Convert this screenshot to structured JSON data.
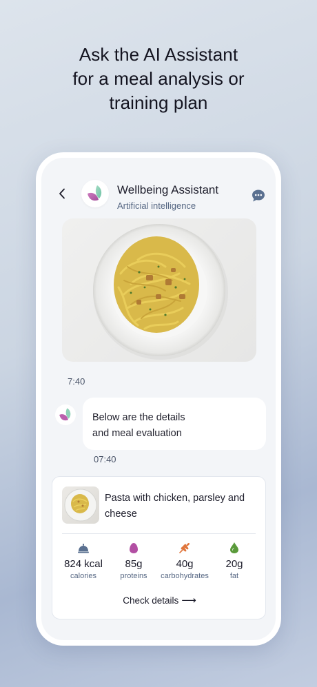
{
  "headline": {
    "line1": "Ask the AI Assistant",
    "line2": "for a meal analysis or",
    "line3": "training plan"
  },
  "header": {
    "title": "Wellbeing Assistant",
    "subtitle": "Artificial intelligence",
    "back_icon": "chevron-left-icon",
    "chat_icon": "chat-bubble-icon"
  },
  "messages": {
    "image_time": "7:40",
    "bot_text_line1": "Below are the details",
    "bot_text_line2": "and meal evaluation",
    "bot_time": "07:40"
  },
  "meal_card": {
    "title": "Pasta with chicken, parsley and cheese",
    "nutrients": [
      {
        "value": "824 kcal",
        "label": "calories",
        "icon": "cloche-icon",
        "color": "#5a7090"
      },
      {
        "value": "85g",
        "label": "proteins",
        "icon": "egg-icon",
        "color": "#b24fa3"
      },
      {
        "value": "40g",
        "label": "carbohydrates",
        "icon": "wheat-icon",
        "color": "#e0753b"
      },
      {
        "value": "20g",
        "label": "fat",
        "icon": "drop-icon",
        "color": "#5a9a3a"
      }
    ],
    "cta": "Check details"
  },
  "colors": {
    "accent_text": "#566783",
    "logo_teal": "#8fd2b7",
    "logo_pink": "#b24fa3"
  }
}
